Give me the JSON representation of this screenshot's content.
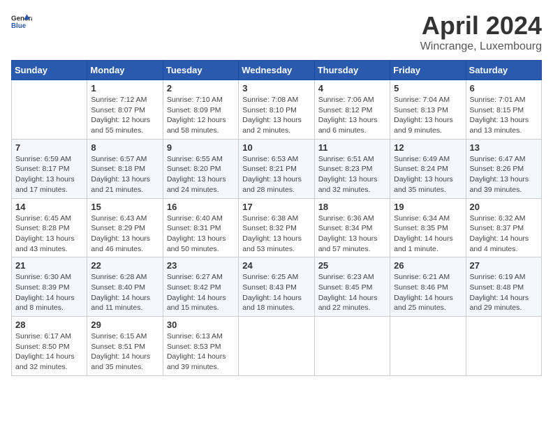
{
  "header": {
    "logo_general": "General",
    "logo_blue": "Blue",
    "month_year": "April 2024",
    "location": "Wincrange, Luxembourg"
  },
  "days_of_week": [
    "Sunday",
    "Monday",
    "Tuesday",
    "Wednesday",
    "Thursday",
    "Friday",
    "Saturday"
  ],
  "weeks": [
    [
      {
        "day": "",
        "sunrise": "",
        "sunset": "",
        "daylight": ""
      },
      {
        "day": "1",
        "sunrise": "Sunrise: 7:12 AM",
        "sunset": "Sunset: 8:07 PM",
        "daylight": "Daylight: 12 hours and 55 minutes."
      },
      {
        "day": "2",
        "sunrise": "Sunrise: 7:10 AM",
        "sunset": "Sunset: 8:09 PM",
        "daylight": "Daylight: 12 hours and 58 minutes."
      },
      {
        "day": "3",
        "sunrise": "Sunrise: 7:08 AM",
        "sunset": "Sunset: 8:10 PM",
        "daylight": "Daylight: 13 hours and 2 minutes."
      },
      {
        "day": "4",
        "sunrise": "Sunrise: 7:06 AM",
        "sunset": "Sunset: 8:12 PM",
        "daylight": "Daylight: 13 hours and 6 minutes."
      },
      {
        "day": "5",
        "sunrise": "Sunrise: 7:04 AM",
        "sunset": "Sunset: 8:13 PM",
        "daylight": "Daylight: 13 hours and 9 minutes."
      },
      {
        "day": "6",
        "sunrise": "Sunrise: 7:01 AM",
        "sunset": "Sunset: 8:15 PM",
        "daylight": "Daylight: 13 hours and 13 minutes."
      }
    ],
    [
      {
        "day": "7",
        "sunrise": "Sunrise: 6:59 AM",
        "sunset": "Sunset: 8:17 PM",
        "daylight": "Daylight: 13 hours and 17 minutes."
      },
      {
        "day": "8",
        "sunrise": "Sunrise: 6:57 AM",
        "sunset": "Sunset: 8:18 PM",
        "daylight": "Daylight: 13 hours and 21 minutes."
      },
      {
        "day": "9",
        "sunrise": "Sunrise: 6:55 AM",
        "sunset": "Sunset: 8:20 PM",
        "daylight": "Daylight: 13 hours and 24 minutes."
      },
      {
        "day": "10",
        "sunrise": "Sunrise: 6:53 AM",
        "sunset": "Sunset: 8:21 PM",
        "daylight": "Daylight: 13 hours and 28 minutes."
      },
      {
        "day": "11",
        "sunrise": "Sunrise: 6:51 AM",
        "sunset": "Sunset: 8:23 PM",
        "daylight": "Daylight: 13 hours and 32 minutes."
      },
      {
        "day": "12",
        "sunrise": "Sunrise: 6:49 AM",
        "sunset": "Sunset: 8:24 PM",
        "daylight": "Daylight: 13 hours and 35 minutes."
      },
      {
        "day": "13",
        "sunrise": "Sunrise: 6:47 AM",
        "sunset": "Sunset: 8:26 PM",
        "daylight": "Daylight: 13 hours and 39 minutes."
      }
    ],
    [
      {
        "day": "14",
        "sunrise": "Sunrise: 6:45 AM",
        "sunset": "Sunset: 8:28 PM",
        "daylight": "Daylight: 13 hours and 43 minutes."
      },
      {
        "day": "15",
        "sunrise": "Sunrise: 6:43 AM",
        "sunset": "Sunset: 8:29 PM",
        "daylight": "Daylight: 13 hours and 46 minutes."
      },
      {
        "day": "16",
        "sunrise": "Sunrise: 6:40 AM",
        "sunset": "Sunset: 8:31 PM",
        "daylight": "Daylight: 13 hours and 50 minutes."
      },
      {
        "day": "17",
        "sunrise": "Sunrise: 6:38 AM",
        "sunset": "Sunset: 8:32 PM",
        "daylight": "Daylight: 13 hours and 53 minutes."
      },
      {
        "day": "18",
        "sunrise": "Sunrise: 6:36 AM",
        "sunset": "Sunset: 8:34 PM",
        "daylight": "Daylight: 13 hours and 57 minutes."
      },
      {
        "day": "19",
        "sunrise": "Sunrise: 6:34 AM",
        "sunset": "Sunset: 8:35 PM",
        "daylight": "Daylight: 14 hours and 1 minute."
      },
      {
        "day": "20",
        "sunrise": "Sunrise: 6:32 AM",
        "sunset": "Sunset: 8:37 PM",
        "daylight": "Daylight: 14 hours and 4 minutes."
      }
    ],
    [
      {
        "day": "21",
        "sunrise": "Sunrise: 6:30 AM",
        "sunset": "Sunset: 8:39 PM",
        "daylight": "Daylight: 14 hours and 8 minutes."
      },
      {
        "day": "22",
        "sunrise": "Sunrise: 6:28 AM",
        "sunset": "Sunset: 8:40 PM",
        "daylight": "Daylight: 14 hours and 11 minutes."
      },
      {
        "day": "23",
        "sunrise": "Sunrise: 6:27 AM",
        "sunset": "Sunset: 8:42 PM",
        "daylight": "Daylight: 14 hours and 15 minutes."
      },
      {
        "day": "24",
        "sunrise": "Sunrise: 6:25 AM",
        "sunset": "Sunset: 8:43 PM",
        "daylight": "Daylight: 14 hours and 18 minutes."
      },
      {
        "day": "25",
        "sunrise": "Sunrise: 6:23 AM",
        "sunset": "Sunset: 8:45 PM",
        "daylight": "Daylight: 14 hours and 22 minutes."
      },
      {
        "day": "26",
        "sunrise": "Sunrise: 6:21 AM",
        "sunset": "Sunset: 8:46 PM",
        "daylight": "Daylight: 14 hours and 25 minutes."
      },
      {
        "day": "27",
        "sunrise": "Sunrise: 6:19 AM",
        "sunset": "Sunset: 8:48 PM",
        "daylight": "Daylight: 14 hours and 29 minutes."
      }
    ],
    [
      {
        "day": "28",
        "sunrise": "Sunrise: 6:17 AM",
        "sunset": "Sunset: 8:50 PM",
        "daylight": "Daylight: 14 hours and 32 minutes."
      },
      {
        "day": "29",
        "sunrise": "Sunrise: 6:15 AM",
        "sunset": "Sunset: 8:51 PM",
        "daylight": "Daylight: 14 hours and 35 minutes."
      },
      {
        "day": "30",
        "sunrise": "Sunrise: 6:13 AM",
        "sunset": "Sunset: 8:53 PM",
        "daylight": "Daylight: 14 hours and 39 minutes."
      },
      {
        "day": "",
        "sunrise": "",
        "sunset": "",
        "daylight": ""
      },
      {
        "day": "",
        "sunrise": "",
        "sunset": "",
        "daylight": ""
      },
      {
        "day": "",
        "sunrise": "",
        "sunset": "",
        "daylight": ""
      },
      {
        "day": "",
        "sunrise": "",
        "sunset": "",
        "daylight": ""
      }
    ]
  ]
}
